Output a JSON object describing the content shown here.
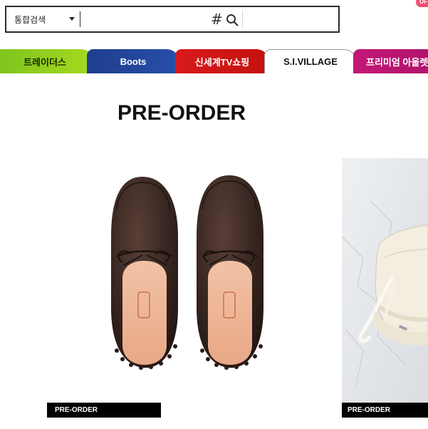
{
  "search": {
    "scope_label": "통합검색",
    "input_value": "",
    "hash_symbol": "#"
  },
  "channel_tabs": [
    {
      "label": "트레이더스",
      "color": "#8fcd1e"
    },
    {
      "label": "Boots",
      "color": "#23469c"
    },
    {
      "label": "신세계TV쇼핑",
      "color": "#d01616"
    },
    {
      "label": "S.I.VILLAGE",
      "color": "#ffffff"
    },
    {
      "label": "프리미엄 아울렛",
      "color": "#b8136f"
    }
  ],
  "tab_badge": "OF",
  "main": {
    "title": "PRE-ORDER",
    "products": [
      {
        "label": "PRE-ORDER",
        "image": "brown-leather-driving-loafers"
      },
      {
        "label": "PRE-ORDER",
        "image": "white-canvas-sneaker"
      }
    ]
  },
  "colors": {
    "text": "#111111",
    "label_bg": "#000000",
    "border": "#2b2b2b"
  }
}
